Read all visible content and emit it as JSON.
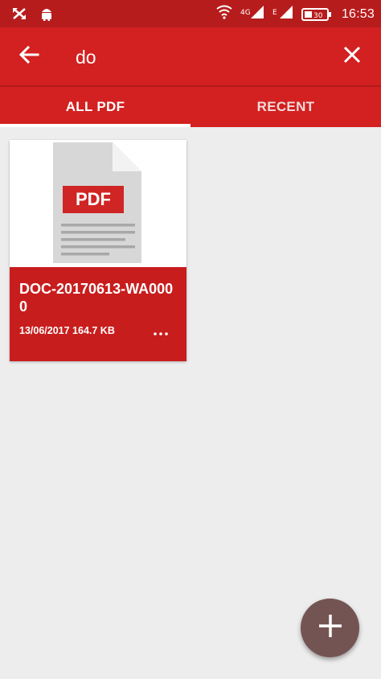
{
  "status_bar": {
    "time": "16:53",
    "left_icons": [
      "crossed-arrows-icon",
      "android-icon"
    ],
    "right_icons": [
      "wifi-icon",
      "signal-icon",
      "signal-icon",
      "battery-icon"
    ],
    "battery_level": "30"
  },
  "app_bar": {
    "back_icon": "back-arrow-icon",
    "search_query": "do",
    "close_icon": "close-icon"
  },
  "tabs": [
    {
      "label": "ALL PDF",
      "selected": true
    },
    {
      "label": "RECENT",
      "selected": false
    }
  ],
  "files": [
    {
      "thumbnail_badge": "PDF",
      "title": "DOC-20170613-WA0000",
      "date": "13/06/2017",
      "size": "164.7 KB",
      "menu_icon": "more-horizontal-icon"
    }
  ],
  "fab": {
    "icon": "plus-icon"
  },
  "colors": {
    "primary": "#d32020",
    "primary_dark": "#b71c1c",
    "card_accent": "#c81d1d",
    "fab": "#735453",
    "background": "#ededed"
  }
}
